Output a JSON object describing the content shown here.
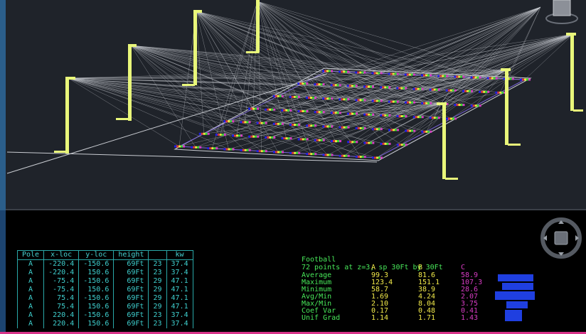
{
  "app": {
    "accent": "#48e85a",
    "viewport_bg": "#1f232a",
    "paper_bg": "#000000"
  },
  "viewport": {
    "pole_color": "#e9f77a",
    "aim_line_color": "#c9ccd2",
    "grid_point_colors": [
      "#2020e8",
      "#d8343a",
      "#ecea3a",
      "#38d838",
      "#d83cc4"
    ]
  },
  "luminaire_table": {
    "headers": [
      "Pole",
      "x-loc",
      "y-loc",
      "height",
      "",
      "kw"
    ],
    "rows": [
      [
        "A",
        "-220.4",
        "-150.6",
        "69Ft",
        "23",
        "37.4"
      ],
      [
        "A",
        "-220.4",
        "150.6",
        "69Ft",
        "23",
        "37.4"
      ],
      [
        "A",
        "-75.4",
        "-150.6",
        "69Ft",
        "29",
        "47.1"
      ],
      [
        "A",
        "-75.4",
        "150.6",
        "69Ft",
        "29",
        "47.1"
      ],
      [
        "A",
        "75.4",
        "-150.6",
        "69Ft",
        "29",
        "47.1"
      ],
      [
        "A",
        "75.4",
        "150.6",
        "69Ft",
        "29",
        "47.1"
      ],
      [
        "A",
        "220.4",
        "-150.6",
        "69Ft",
        "23",
        "37.4"
      ],
      [
        "A",
        "220.4",
        "150.6",
        "69Ft",
        "23",
        "37.4"
      ]
    ]
  },
  "calc_summary": {
    "title": "Football",
    "subtitle": "72 points at z=3, sp 30Ft by 30Ft",
    "col_heads": [
      "A",
      "B",
      "C"
    ],
    "rows": [
      {
        "label": "Average",
        "a": "99.3",
        "b": "81.6",
        "c": "58.9"
      },
      {
        "label": "Maximum",
        "a": "123.4",
        "b": "151.1",
        "c": "107.3"
      },
      {
        "label": "Minimum",
        "a": "58.7",
        "b": "38.9",
        "c": "28.6"
      },
      {
        "label": "Avg/Min",
        "a": "1.69",
        "b": "4.24",
        "c": "2.07"
      },
      {
        "label": "Max/Min",
        "a": "2.10",
        "b": "8.04",
        "c": "3.75"
      },
      {
        "label": "Coef Var",
        "a": "0.17",
        "b": "0.48",
        "c": "0.41"
      },
      {
        "label": "Unif Grad",
        "a": "1.14",
        "b": "1.71",
        "c": "1.43"
      }
    ]
  }
}
